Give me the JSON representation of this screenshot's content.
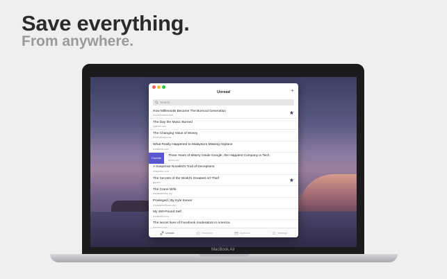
{
  "hero": {
    "headline": "Save everything.",
    "subheadline": "From anywhere."
  },
  "device": {
    "model_label": "MacBook Air"
  },
  "window": {
    "title": "Unread",
    "add_icon": "plus-icon",
    "search_placeholder": "Search"
  },
  "articles": [
    {
      "title": "How Millennials Became The Burnout Generation",
      "domain": "buzzfeednews.com",
      "starred": true
    },
    {
      "title": "The Day the Music Burned",
      "domain": "nytimes.com",
      "starred": false
    },
    {
      "title": "The Changing Value of Money",
      "domain": "theverybody.com",
      "starred": false
    },
    {
      "title": "What Really Happened to Malaysia's Missing Airplane",
      "domain": "theatlantic.com",
      "starred": false
    },
    {
      "title": "Three Years of Misery Inside Google, the Happiest Company in Tech.",
      "domain": "wired.com",
      "starred": false,
      "swipe_label": "Favorite"
    },
    {
      "title": "A Suspense Novelist's Trail of Deceptions",
      "domain": "newyorker.com",
      "starred": false
    },
    {
      "title": "The Secrets of the World's Greatest Art Thief",
      "domain": "gq.com",
      "starred": true
    },
    {
      "title": "The Crane Wife",
      "domain": "theparisreview.org",
      "starred": false
    },
    {
      "title": "Privileged | By Kyle Korver",
      "domain": "theplayerstribune.com",
      "starred": false
    },
    {
      "title": "My 460-Pound Self",
      "domain": "theatlantic.com",
      "starred": false
    },
    {
      "title": "The secret lives of Facebook moderators in America",
      "domain": "theverge.com",
      "starred": false
    }
  ],
  "tabs": [
    {
      "label": "Unread",
      "icon": "link-icon",
      "active": true
    },
    {
      "label": "Favorites",
      "icon": "star-icon",
      "active": false
    },
    {
      "label": "Archives",
      "icon": "archive-icon",
      "active": false
    },
    {
      "label": "Settings",
      "icon": "settings-icon",
      "active": false
    }
  ],
  "colors": {
    "swipe_action": "#5b57d1",
    "star": "#4a4d6a",
    "background": "#efefef"
  }
}
